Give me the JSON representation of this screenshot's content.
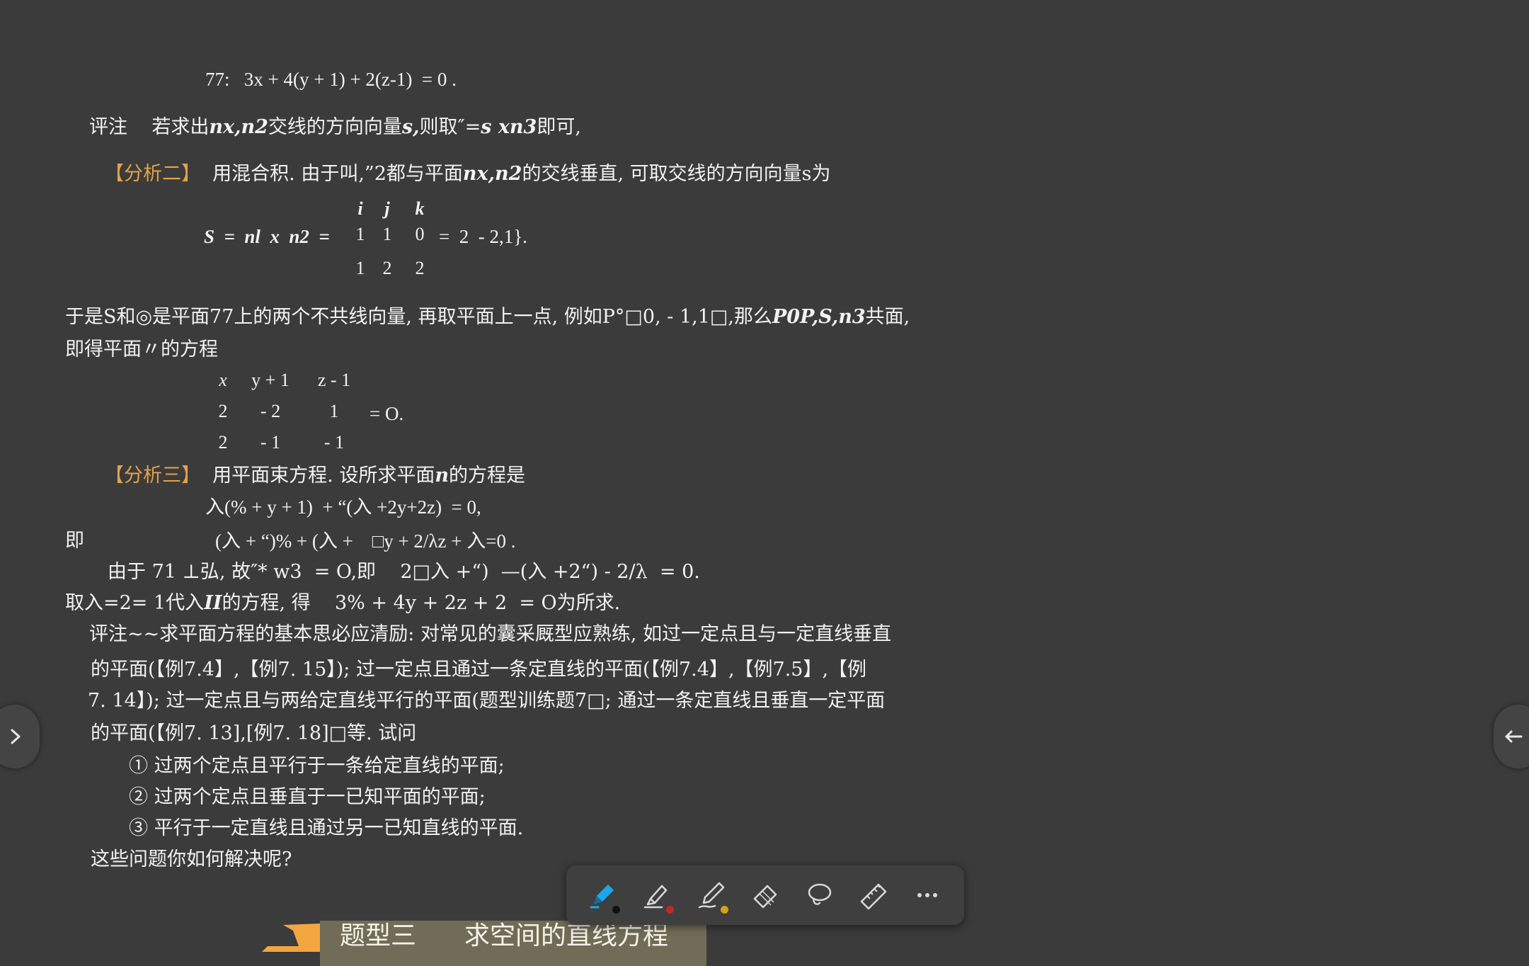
{
  "doc": {
    "eq_top": "77:   3x + 4(y + 1) + 2(z-1)  = 0 .",
    "remark1_label": "评注",
    "remark1_text_a": "若求出",
    "remark1_bold_a": "nx,n2",
    "remark1_text_b": "交线的方向向量",
    "remark1_bold_b": "s,",
    "remark1_text_c": "则取″=",
    "remark1_bold_c": "s xn3",
    "remark1_text_d": "即可,",
    "analysis2_label": "【分析二】",
    "analysis2_text_a": "用混合积. 由于叫,”2都与平面",
    "analysis2_bold": "nx,n2",
    "analysis2_text_b": "的交线垂直, 可取交线的方向向量s为",
    "matrix1": {
      "row0": [
        "i",
        "j",
        "k"
      ],
      "lhs": "S  =  nl  x  n2  =",
      "row1": [
        "1",
        "1",
        "0"
      ],
      "rhs": "=  2  - 2,1}.",
      "row2": [
        "1",
        "2",
        "2"
      ]
    },
    "para2_line1_a": "于是S和◎是平面77上的两个不共线向量, 再取平面上一点, 例如P°□0, - 1,1□,那么",
    "para2_line1_bold": "P0P,S,n3",
    "para2_line1_b": "共面,",
    "para2_line2": "即得平面〃的方程",
    "matrix2": {
      "row0": [
        "x",
        "y + 1",
        "z - 1"
      ],
      "row1": [
        "2",
        "- 2",
        "1"
      ],
      "row1_rhs": "= O.",
      "row2": [
        "2",
        "- 1",
        "- 1"
      ]
    },
    "analysis3_label": "【分析三】",
    "analysis3_text_a": "用平面束方程. 设所求平面",
    "analysis3_bold": "n",
    "analysis3_text_b": "的方程是",
    "eq_a": "入(% + y + 1)  + “(入 +2y+2z)  = 0,",
    "ji_label": "即",
    "eq_b": "(入 + “)% + (入 +    □y + 2/λz + 入=0 .",
    "eq_c": "由于 71 ⊥弘, 故″* w3  = O,即    2□入 +“)  —(入 +2“) - 2/λ  = 0.",
    "eq_d_a": "取入=2= 1代入",
    "eq_d_bold": "II",
    "eq_d_b": "的方程, 得    3% + 4y + 2z + 2  = O为所求.",
    "remark2_line1": "评注~~求平面方程的基本思必应清励: 对常见的囊采厩型应熟练, 如过一定点且与一定直线垂直",
    "remark2_line2": "的平面(【例7.4】,【例7. 15】); 过一定点且通过一条定直线的平面(【例7.4】,【例7.5】,【例",
    "remark2_line3": "7. 14】); 过一定点且与两给定直线平行的平面(题型训练题7□; 通过一条定直线且垂直一定平面",
    "remark2_line4": "的平面(【例7. 13],[例7. 18]□等. 试问",
    "q1": "① 过两个定点且平行于一条给定直线的平面;",
    "q2": "② 过两个定点且垂直于一已知平面的平面;",
    "q3": "③ 平行于一定直线且通过另一已知直线的平面.",
    "closing": "这些问题你如何解决呢?",
    "section_title_a": "题型三",
    "section_title_b": "求空间的直线方程"
  },
  "toolbar": {
    "tools": [
      {
        "name": "pen-icon",
        "dot": "#111111"
      },
      {
        "name": "highlighter-icon",
        "dot": "#c0272d"
      },
      {
        "name": "pencil-icon",
        "dot": "#d4a017"
      },
      {
        "name": "eraser-icon"
      },
      {
        "name": "lasso-icon"
      },
      {
        "name": "ruler-icon"
      },
      {
        "name": "more-icon"
      }
    ],
    "active_color": "#1ea7e8"
  }
}
